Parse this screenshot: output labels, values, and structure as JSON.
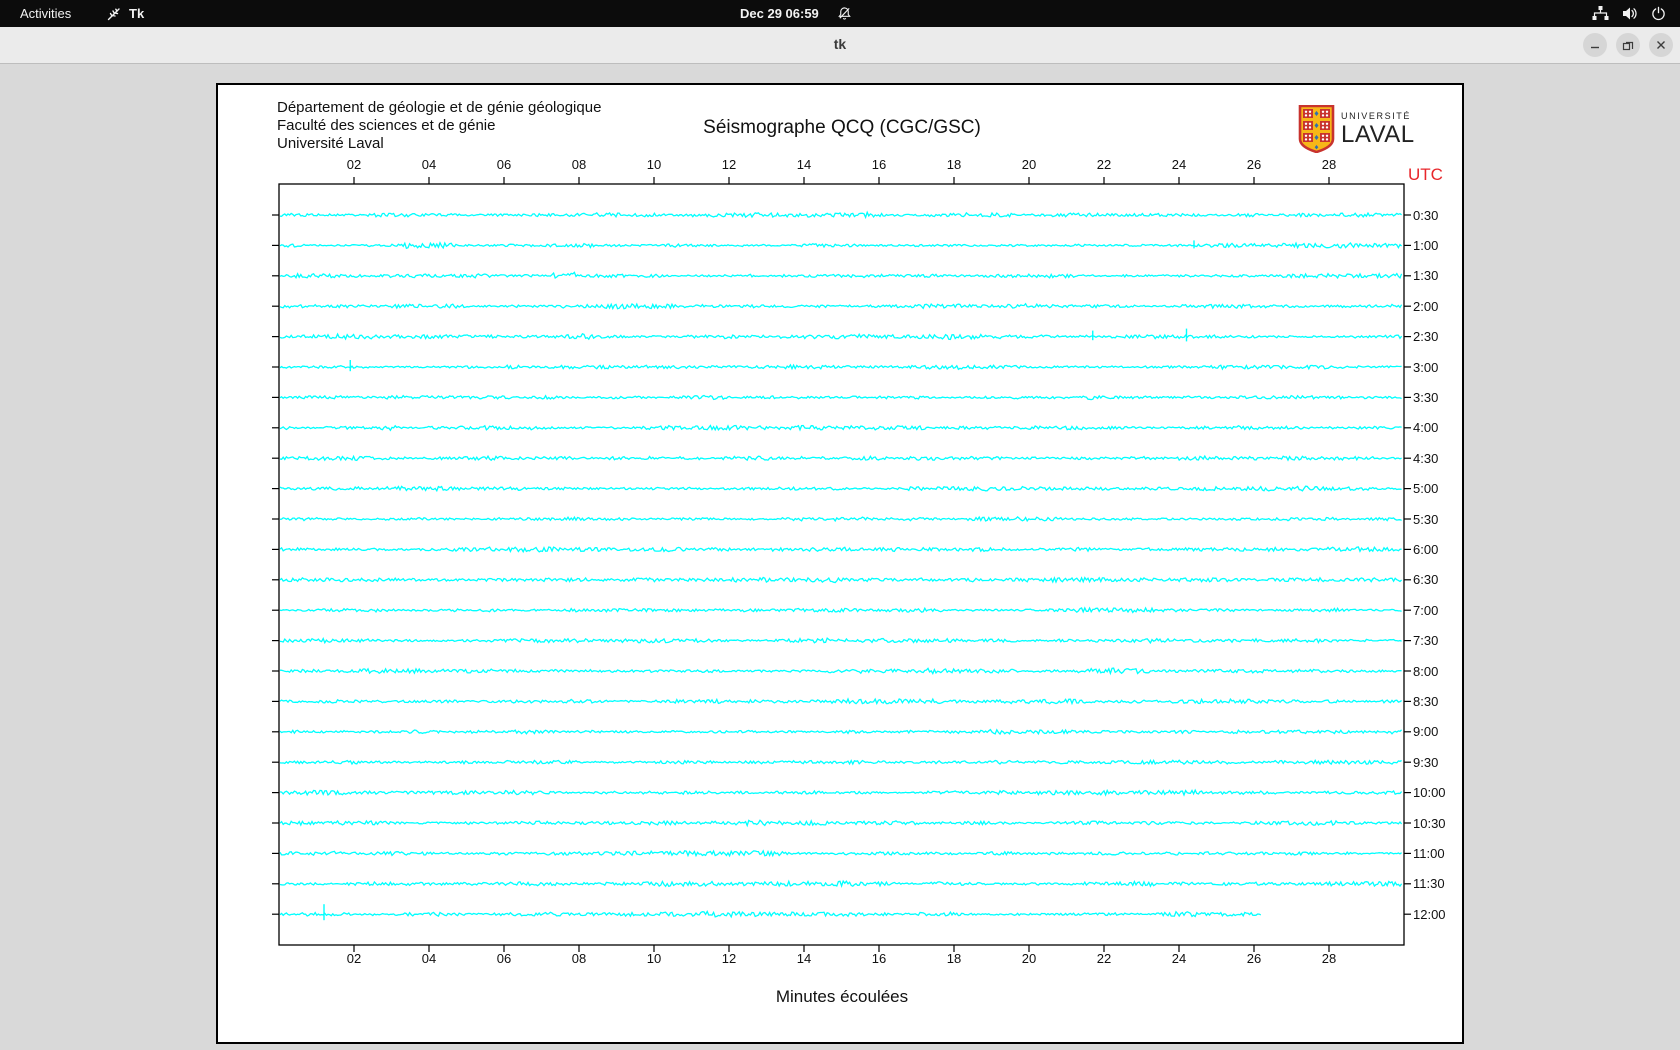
{
  "top_bar": {
    "activities_label": "Activities",
    "app_name": "Tk",
    "clock": "Dec 29  06:59"
  },
  "window": {
    "title": "tk"
  },
  "page": {
    "institution_lines": [
      "Département de géologie et de génie géologique",
      "Faculté des sciences et de génie",
      "Université Laval"
    ],
    "title": "Séismographe QCQ (CGC/GSC)",
    "logo": {
      "top_text": "UNIVERSITÉ",
      "bottom_text": "LAVAL"
    }
  },
  "chart_data": {
    "type": "line",
    "title": "Séismographe QCQ (CGC/GSC)",
    "xlabel": "Minutes écoulées",
    "right_axis_title": "UTC",
    "x_ticks": [
      "02",
      "04",
      "06",
      "08",
      "10",
      "12",
      "14",
      "16",
      "18",
      "20",
      "22",
      "24",
      "26",
      "28"
    ],
    "x_range_minutes": [
      0,
      30
    ],
    "rows": [
      "0:30",
      "1:00",
      "1:30",
      "2:00",
      "2:30",
      "3:00",
      "3:30",
      "4:00",
      "4:30",
      "5:00",
      "5:30",
      "6:00",
      "6:30",
      "7:00",
      "7:30",
      "8:00",
      "8:30",
      "9:00",
      "9:30",
      "10:00",
      "10:30",
      "11:00",
      "11:30",
      "12:00"
    ],
    "last_row_end_minute": 26.2,
    "trace_color": "#00ffff",
    "utc_color": "#e8262b",
    "axis_color": "#000000",
    "events": [
      {
        "row": 1,
        "kind": "burst",
        "m0": 3.3,
        "m1": 4.6,
        "amp": 2.3
      },
      {
        "row": 1,
        "kind": "spike",
        "m": 24.4,
        "amp": 5
      },
      {
        "row": 2,
        "kind": "burst",
        "m0": 7.3,
        "m1": 7.9,
        "amp": 2.8
      },
      {
        "row": 4,
        "kind": "spike",
        "m": 21.7,
        "amp": 6
      },
      {
        "row": 4,
        "kind": "spike",
        "m": 24.2,
        "amp": 8
      },
      {
        "row": 5,
        "kind": "spike",
        "m": 1.9,
        "amp": 7
      },
      {
        "row": 7,
        "kind": "burst",
        "m0": 2.5,
        "m1": 3.3,
        "amp": 1.7
      },
      {
        "row": 15,
        "kind": "burst",
        "m0": 21.3,
        "m1": 23.2,
        "amp": 1.9
      },
      {
        "row": 23,
        "kind": "spike",
        "m": 1.2,
        "amp": 10
      }
    ]
  }
}
